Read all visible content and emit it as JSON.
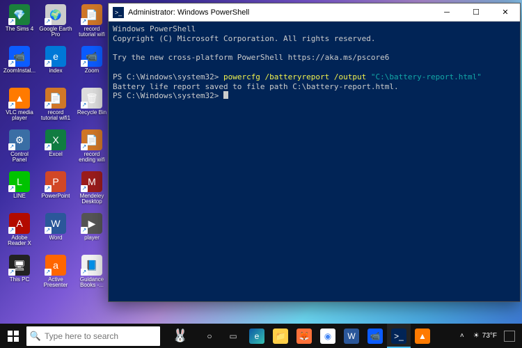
{
  "desktop_icons": [
    {
      "label": "The Sims 4",
      "bg": "#1a7f3c",
      "glyph": "💎"
    },
    {
      "label": "Google Earth Pro",
      "bg": "#cccccc",
      "glyph": "🌍"
    },
    {
      "label": "record tutorial wifi",
      "bg": "#d07728",
      "glyph": "📄"
    },
    {
      "label": "ZoomInstal...",
      "bg": "#0b5cff",
      "glyph": "📹"
    },
    {
      "label": "index",
      "bg": "#0078d7",
      "glyph": "e"
    },
    {
      "label": "Zoom",
      "bg": "#0b5cff",
      "glyph": "📹"
    },
    {
      "label": "VLC media player",
      "bg": "#ff7a00",
      "glyph": "▲"
    },
    {
      "label": "record tutorial wifi1",
      "bg": "#d07728",
      "glyph": "📄"
    },
    {
      "label": "Recycle Bin",
      "bg": "#dddddd",
      "glyph": "🗑"
    },
    {
      "label": "Control Panel",
      "bg": "#3a6ea5",
      "glyph": "⚙"
    },
    {
      "label": "Excel",
      "bg": "#107c41",
      "glyph": "X"
    },
    {
      "label": "record ending wifi",
      "bg": "#d07728",
      "glyph": "📄"
    },
    {
      "label": "LINE",
      "bg": "#00c300",
      "glyph": "L"
    },
    {
      "label": "PowerPoint",
      "bg": "#d24726",
      "glyph": "P"
    },
    {
      "label": "Mendeley Desktop",
      "bg": "#9b1c1c",
      "glyph": "M"
    },
    {
      "label": "Adobe Reader X",
      "bg": "#b30b00",
      "glyph": "A"
    },
    {
      "label": "Word",
      "bg": "#2b579a",
      "glyph": "W"
    },
    {
      "label": "player",
      "bg": "#555555",
      "glyph": "▶"
    },
    {
      "label": "This PC",
      "bg": "#222222",
      "glyph": "🖥"
    },
    {
      "label": "Active Presenter",
      "bg": "#ff6600",
      "glyph": "a"
    },
    {
      "label": "Guidance Books -...",
      "bg": "#f2f2f2",
      "glyph": "📘"
    }
  ],
  "powershell": {
    "title": "Administrator: Windows PowerShell",
    "line1": "Windows PowerShell",
    "line2": "Copyright (C) Microsoft Corporation. All rights reserved.",
    "line3": "Try the new cross-platform PowerShell https://aka.ms/pscore6",
    "prompt1_pre": "PS C:\\Windows\\system32> ",
    "prompt1_cmd": "powercfg /batteryreport /output ",
    "prompt1_str": "\"C:\\battery-report.html\"",
    "result": "Battery life report saved to file path C:\\battery-report.html.",
    "prompt2": "PS C:\\Windows\\system32> "
  },
  "taskbar": {
    "search_placeholder": "Type here to search",
    "items": [
      {
        "name": "cortana",
        "bg": "transparent",
        "glyph": "○",
        "color": "#ffffff"
      },
      {
        "name": "task-view",
        "bg": "transparent",
        "glyph": "▭",
        "color": "#cccccc"
      },
      {
        "name": "edge",
        "bg": "linear-gradient(135deg,#0c59a4,#37c2b1)",
        "glyph": "e"
      },
      {
        "name": "explorer",
        "bg": "#ffcf48",
        "glyph": "📁"
      },
      {
        "name": "firefox",
        "bg": "#ff7139",
        "glyph": "🦊"
      },
      {
        "name": "chrome",
        "bg": "#ffffff",
        "glyph": "◉",
        "color": "#4285f4"
      },
      {
        "name": "word",
        "bg": "#2b579a",
        "glyph": "W"
      },
      {
        "name": "zoom",
        "bg": "#0b5cff",
        "glyph": "📹"
      },
      {
        "name": "powershell",
        "bg": "#012456",
        "glyph": ">_",
        "active": true
      },
      {
        "name": "vlc",
        "bg": "#ff7a00",
        "glyph": "▲"
      }
    ],
    "temp": "73°F",
    "weather_icon": "☀"
  }
}
